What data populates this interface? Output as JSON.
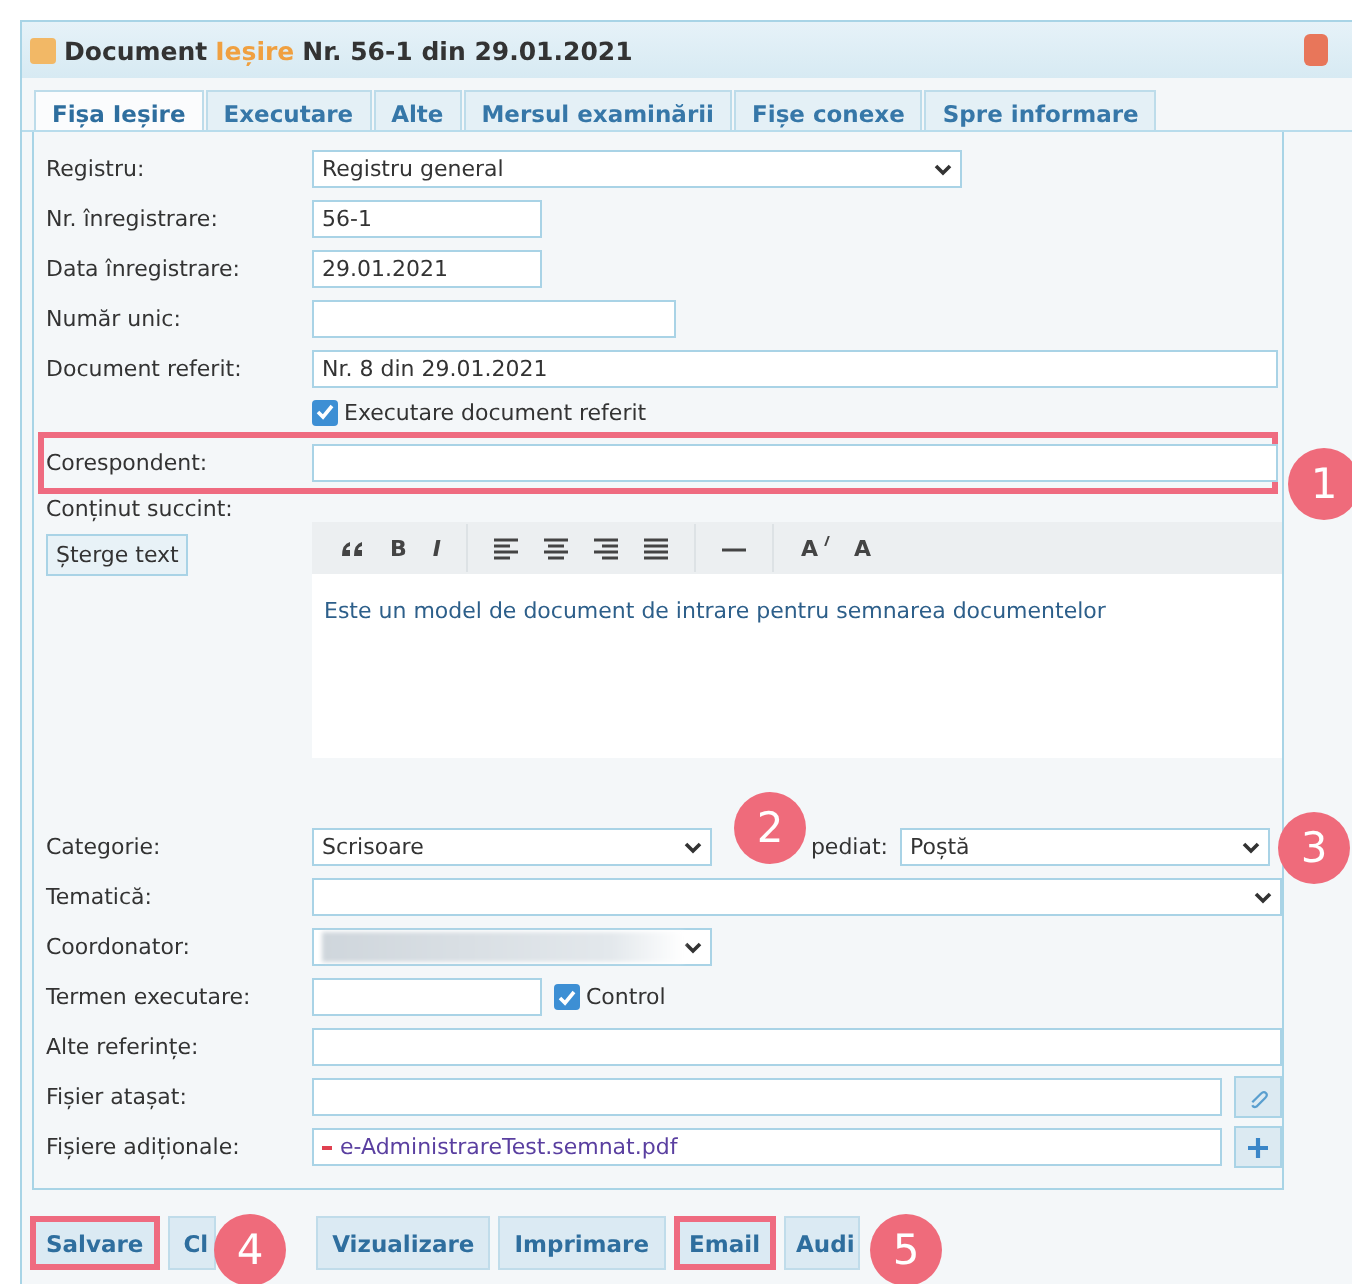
{
  "window": {
    "title": "Document",
    "doc_type": "Ieșire",
    "title_rest": "Nr. 56-1 din 29.01.2021"
  },
  "tabs": [
    {
      "label": "Fișa Ieșire",
      "selected": true
    },
    {
      "label": "Executare",
      "selected": false
    },
    {
      "label": "Alte",
      "selected": false
    },
    {
      "label": "Mersul examinării",
      "selected": false
    },
    {
      "label": "Fișe conexe",
      "selected": false
    },
    {
      "label": "Spre informare",
      "selected": false
    }
  ],
  "rows": [
    {
      "kind": "select",
      "label": "Registru:",
      "value": "Registru general"
    },
    {
      "kind": "text",
      "label": "Nr. înregistrare:",
      "value": "56-1"
    },
    {
      "kind": "text",
      "label": "Data înregistrare:",
      "value": "29.01.2021"
    },
    {
      "kind": "text",
      "label": "Număr unic:"
    },
    {
      "kind": "text",
      "label": "Document referit:",
      "value": "Nr. 8 din 29.01.2021"
    },
    {
      "kind": "checkbox",
      "label": "Executare document referit",
      "checked": true
    },
    {
      "kind": "text",
      "label": "Corespondent:",
      "highlighted": true
    },
    {
      "kind": "editor",
      "label": "Conținut succint:",
      "button": "Șterge text",
      "text": "Este un model de document de intrare pentru semnarea documentelor",
      "toolbar": [
        {
          "kind": "quote"
        },
        {
          "kind": "bold",
          "label": "B"
        },
        {
          "kind": "italic",
          "label": "I"
        },
        {
          "kind": "align-left"
        },
        {
          "kind": "align-center"
        },
        {
          "kind": "align-right"
        },
        {
          "kind": "justify"
        },
        {
          "kind": "rule"
        },
        {
          "kind": "superscript",
          "label": "A"
        },
        {
          "kind": "subscript",
          "label": "A"
        }
      ]
    },
    {
      "kind": "select-pair",
      "label": "Categorie:",
      "value": "Scrisoare",
      "second_label": "pediat:",
      "second_value": "Poștă"
    },
    {
      "kind": "select",
      "label": "Tematică:"
    },
    {
      "kind": "masked-select",
      "label": "Coordonator:"
    },
    {
      "kind": "text-check",
      "label": "Termen executare:",
      "check_label": "Control",
      "checked": true
    },
    {
      "kind": "text",
      "label": "Alte referințe:"
    },
    {
      "kind": "file",
      "label": "Fișier atașat:",
      "button": {
        "kind": "attach"
      }
    },
    {
      "kind": "file",
      "label": "Fișiere adiționale:",
      "button": {
        "kind": "add"
      },
      "items": [
        {
          "name": "e-AdministrareTest.semnat.pdf"
        }
      ]
    }
  ],
  "buttons": [
    {
      "label": "Salvare",
      "highlighted": true
    },
    {
      "label": "Cl",
      "highlighted": false
    },
    {
      "label": "Vizualizare",
      "highlighted": false
    },
    {
      "label": "Imprimare",
      "highlighted": false
    },
    {
      "label": "Email",
      "highlighted": true
    },
    {
      "label": "Audi",
      "highlighted": false
    }
  ],
  "callouts": [
    {
      "label": "1"
    },
    {
      "label": "2"
    },
    {
      "label": "3"
    },
    {
      "label": "4"
    },
    {
      "label": "5"
    }
  ]
}
